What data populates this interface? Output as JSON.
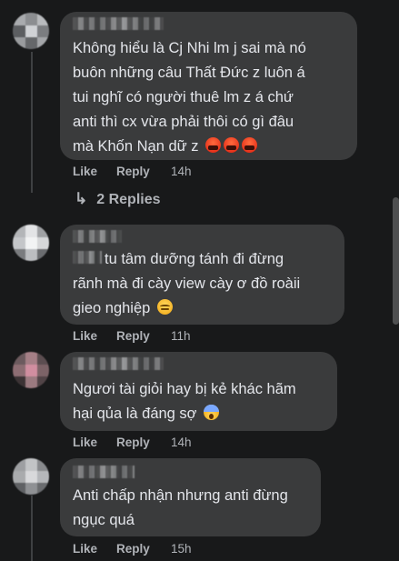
{
  "comments": [
    {
      "lines": [
        "Không hiểu là Cj Nhi lm j sai mà nó",
        "buôn những câu Thất Đức z luôn á",
        "tui nghĩ có người thuê lm z á chứ",
        "anti thì cx vừa phải thôi có gì đâu",
        "mà Khốn Nạn dữ z"
      ],
      "emoji": [
        "angry-face-icon",
        "angry-face-icon",
        "angry-face-icon"
      ],
      "like": "Like",
      "reply": "Reply",
      "time": "14h"
    },
    {
      "lines": [
        "tu tâm dưỡng tánh đi đừng",
        "rãnh mà đi cày view cày ơ đồ roàii",
        "gieo nghiệp"
      ],
      "emoji": [
        "downcast-sweat-face-icon"
      ],
      "like": "Like",
      "reply": "Reply",
      "time": "11h"
    },
    {
      "lines": [
        "Ngươi tài giỏi hay bị kẻ khác hãm",
        "hại qủa là đáng sợ"
      ],
      "emoji": [
        "screaming-face-icon"
      ],
      "like": "Like",
      "reply": "Reply",
      "time": "14h"
    },
    {
      "lines": [
        "Anti chấp nhận nhưng anti đừng",
        "ngục quá"
      ],
      "emoji": [],
      "like": "Like",
      "reply": "Reply",
      "time": "15h"
    }
  ],
  "replies_label": "2 Replies",
  "colors": {
    "background": "#18191a",
    "bubble": "#3a3b3c",
    "text": "#e4e6eb",
    "muted": "#b0b3b8"
  }
}
